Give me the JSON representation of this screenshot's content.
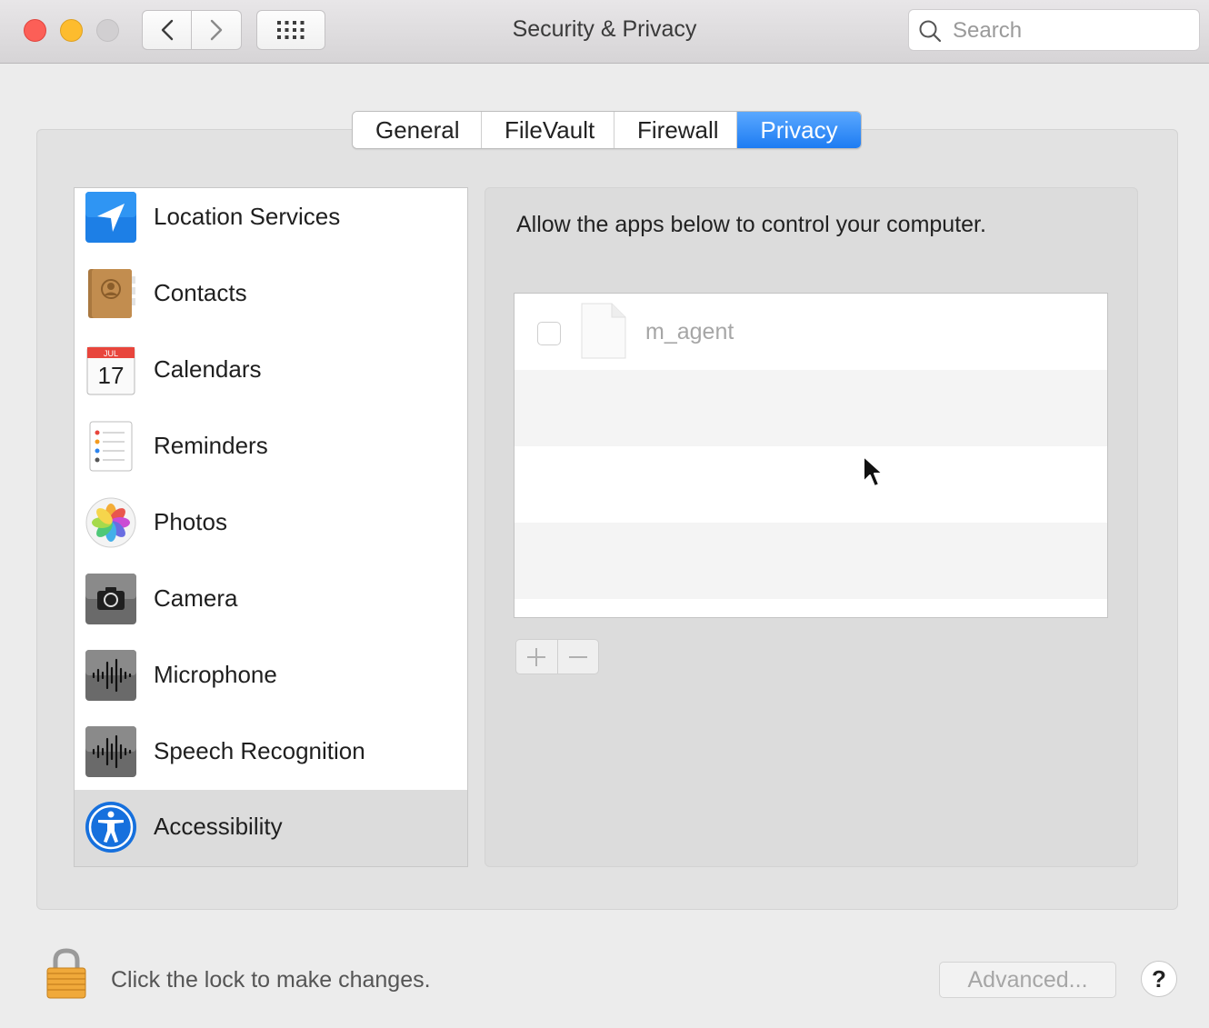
{
  "window": {
    "title": "Security & Privacy",
    "search_placeholder": "Search"
  },
  "tabs": [
    {
      "label": "General"
    },
    {
      "label": "FileVault"
    },
    {
      "label": "Firewall"
    },
    {
      "label": "Privacy",
      "active": true
    }
  ],
  "sidebar": {
    "items": [
      {
        "label": "Location Services",
        "icon": "location-arrow-icon"
      },
      {
        "label": "Contacts",
        "icon": "contacts-book-icon"
      },
      {
        "label": "Calendars",
        "icon": "calendar-icon",
        "calendar_month": "JUL",
        "calendar_day": "17"
      },
      {
        "label": "Reminders",
        "icon": "reminders-list-icon"
      },
      {
        "label": "Photos",
        "icon": "photos-flower-icon"
      },
      {
        "label": "Camera",
        "icon": "camera-icon"
      },
      {
        "label": "Microphone",
        "icon": "waveform-icon"
      },
      {
        "label": "Speech Recognition",
        "icon": "waveform-icon"
      },
      {
        "label": "Accessibility",
        "icon": "accessibility-icon",
        "selected": true
      }
    ]
  },
  "panel": {
    "description": "Allow the apps below to control your computer.",
    "apps": [
      {
        "name": "m_agent",
        "checked": false,
        "icon": "document-icon"
      }
    ]
  },
  "footer": {
    "lock_text": "Click the lock to make changes.",
    "advanced_label": "Advanced...",
    "help_label": "?"
  },
  "colors": {
    "accent": "#1e7cf2",
    "close": "#fc5f57",
    "minimize": "#fdbc2e",
    "zoom_disabled": "#d1cfd1"
  }
}
